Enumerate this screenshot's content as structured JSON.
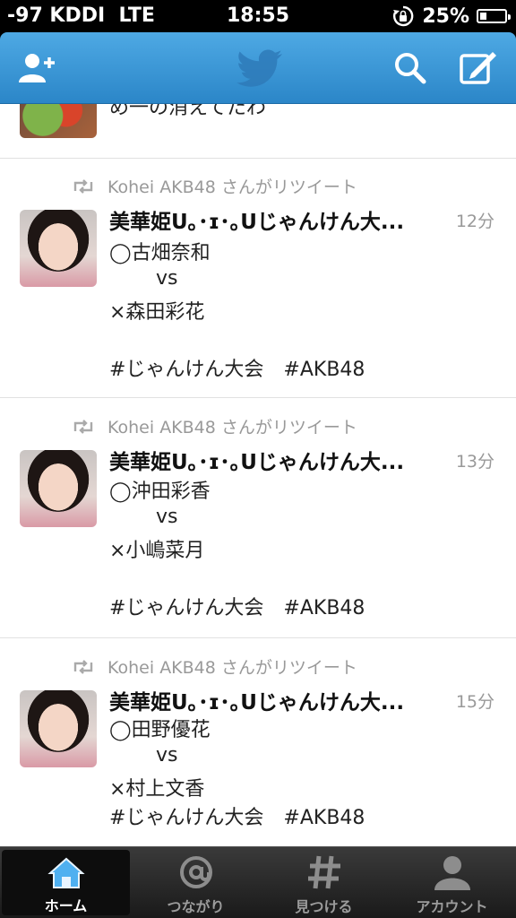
{
  "status_bar": {
    "signal": "-97 KDDI",
    "network": "LTE",
    "time": "18:55",
    "battery": "25%",
    "battery_level": 0.25
  },
  "nav": {
    "icons": {
      "add_user": "add-user-icon",
      "logo": "twitter-bird-icon",
      "search": "search-icon",
      "compose": "compose-icon"
    }
  },
  "partial_tweet": {
    "text": "め一の消えてたわ"
  },
  "tweets": [
    {
      "retweeted_by": "Kohei AKB48 さんがリツイート",
      "author": "美華姫U｡･ɪ･｡Uじゃんけん大...",
      "time": "12分",
      "lines": [
        "◯古畑奈和",
        "vs",
        "×森田彩花",
        "",
        "#じゃんけん大会　#AKB48"
      ]
    },
    {
      "retweeted_by": "Kohei AKB48 さんがリツイート",
      "author": "美華姫U｡･ɪ･｡Uじゃんけん大...",
      "time": "13分",
      "lines": [
        "◯沖田彩香",
        "vs",
        "×小嶋菜月",
        "",
        "#じゃんけん大会　#AKB48"
      ]
    },
    {
      "retweeted_by": "Kohei AKB48 さんがリツイート",
      "author": "美華姫U｡･ɪ･｡Uじゃんけん大...",
      "time": "15分",
      "lines": [
        "◯田野優花",
        "vs",
        "×村上文香",
        "#じゃんけん大会　#AKB48"
      ]
    }
  ],
  "tabbar": {
    "tabs": [
      {
        "label": "ホーム",
        "icon": "home-icon",
        "active": true
      },
      {
        "label": "つながり",
        "icon": "at-icon",
        "active": false
      },
      {
        "label": "見つける",
        "icon": "hashtag-icon",
        "active": false
      },
      {
        "label": "アカウント",
        "icon": "account-icon",
        "active": false
      }
    ]
  },
  "colors": {
    "nav_blue": "#3a98d8",
    "tab_active": "#0d0d0d",
    "meta_gray": "#999999"
  }
}
